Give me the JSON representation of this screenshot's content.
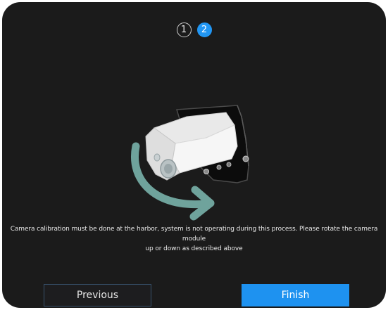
{
  "stepper": {
    "steps": [
      "1",
      "2"
    ],
    "active_step": 2
  },
  "message": {
    "line1": "Camera calibration must be done at the harbor, system is not operating during this process. Please rotate the camera module",
    "line2": "up or down as described above"
  },
  "buttons": {
    "previous_label": "Previous",
    "finish_label": "Finish"
  },
  "colors": {
    "background": "#1b1b1b",
    "accent": "#1e92f0",
    "arrow": "#6fa39c",
    "previous_border": "#37506b"
  },
  "icons": {
    "illustration": "camera-module-rotation-illustration",
    "arrow": "curved-rotate-arrow-icon"
  }
}
